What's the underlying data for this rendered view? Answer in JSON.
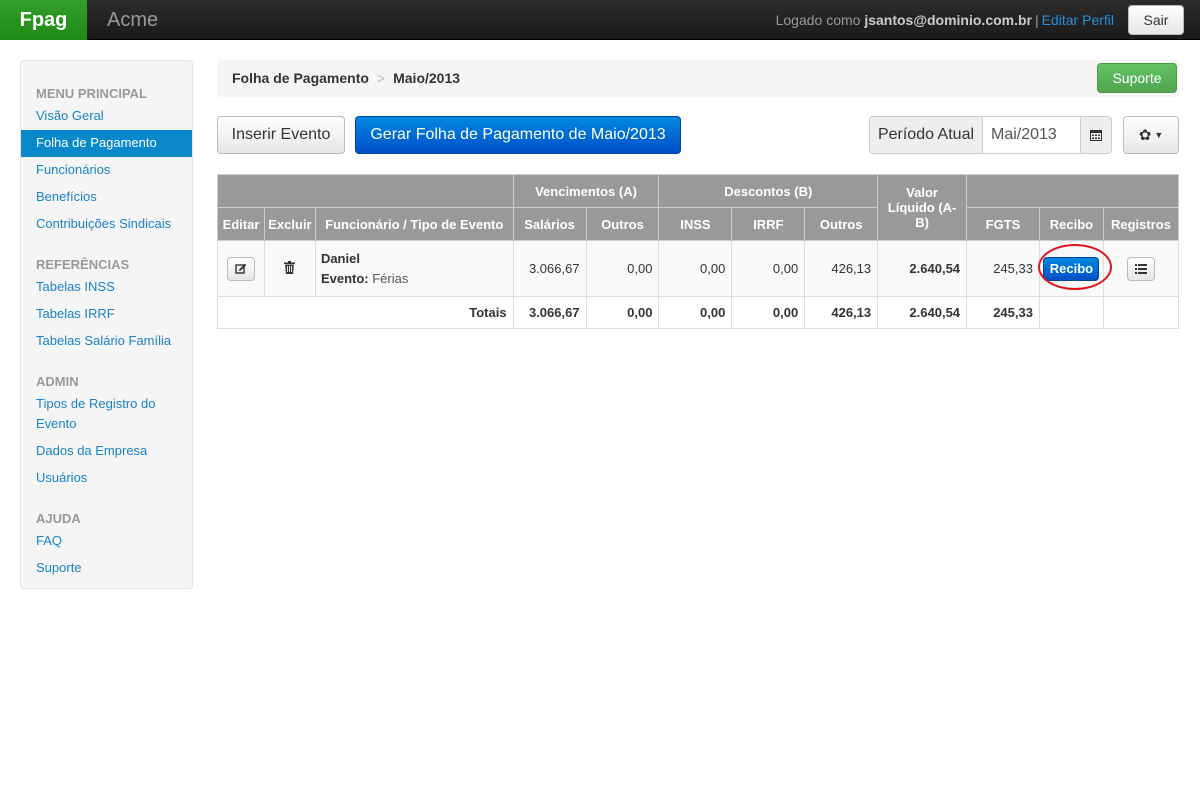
{
  "navbar": {
    "brand": "Fpag",
    "company": "Acme",
    "logged_prefix": "Logado como ",
    "logged_user": "jsantos@dominio.com.br",
    "separator": "|",
    "profile_link": "Editar Perfil",
    "logout": "Sair"
  },
  "sidebar": {
    "sections": [
      {
        "header": "MENU PRINCIPAL",
        "items": [
          "Visão Geral",
          "Folha de Pagamento",
          "Funcionários",
          "Benefícios",
          "Contribuições Sindicais"
        ],
        "active": "Folha de Pagamento"
      },
      {
        "header": "REFERÊNCIAS",
        "items": [
          "Tabelas INSS",
          "Tabelas IRRF",
          "Tabelas Salário Família"
        ]
      },
      {
        "header": "ADMIN",
        "items": [
          "Tipos de Registro do Evento",
          "Dados da Empresa",
          "Usuários"
        ]
      },
      {
        "header": "AJUDA",
        "items": [
          "FAQ",
          "Suporte"
        ]
      }
    ]
  },
  "breadcrumb": {
    "items": [
      "Folha de Pagamento",
      "Maio/2013"
    ],
    "separator": ">",
    "support_button": "Suporte"
  },
  "actions": {
    "insert_event": "Inserir Evento",
    "generate_payroll": "Gerar Folha de Pagamento de Maio/2013",
    "period_label": "Período Atual",
    "period_value": "Mai/2013"
  },
  "table": {
    "group_headers": {
      "vencimentos": "Vencimentos (A)",
      "descontos": "Descontos (B)",
      "valor_liquido": "Valor Líquido (A-B)"
    },
    "columns": [
      "Editar",
      "Excluir",
      "Funcionário / Tipo de Evento",
      "Salários",
      "Outros",
      "INSS",
      "IRRF",
      "Outros",
      "FGTS",
      "Recibo",
      "Registros"
    ],
    "rows": [
      {
        "employee": "Daniel",
        "event_label": "Evento:",
        "event_type": "Férias",
        "salarios": "3.066,67",
        "outros_venc": "0,00",
        "inss": "0,00",
        "irrf": "0,00",
        "outros_desc": "426,13",
        "valor_liquido": "2.640,54",
        "fgts": "245,33",
        "recibo_button": "Recibo"
      }
    ],
    "totals": {
      "label": "Totais",
      "salarios": "3.066,67",
      "outros_venc": "0,00",
      "inss": "0,00",
      "irrf": "0,00",
      "outros_desc": "426,13",
      "valor_liquido": "2.640,54",
      "fgts": "245,33"
    }
  }
}
